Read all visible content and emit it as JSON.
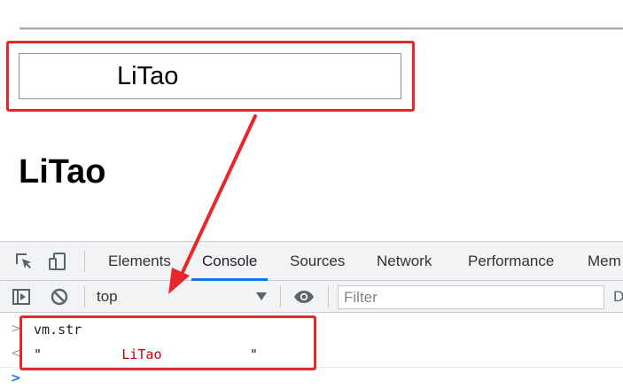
{
  "page": {
    "input_value": "LiTao",
    "heading": "LiTao"
  },
  "devtools": {
    "tabs": [
      {
        "label": "Elements",
        "active": false
      },
      {
        "label": "Console",
        "active": true
      },
      {
        "label": "Sources",
        "active": false
      },
      {
        "label": "Network",
        "active": false
      },
      {
        "label": "Performance",
        "active": false
      },
      {
        "label": "Mem",
        "active": false
      }
    ],
    "toolbar_icons": [
      "inspect-element-icon",
      "device-toggle-icon"
    ],
    "console_toolbar": {
      "context": "top",
      "filter_placeholder": "Filter",
      "truncated_label": "D"
    },
    "console": {
      "command_gutter": ">",
      "command": "vm.str",
      "result_gutter": "<",
      "result_quote_open": "\"",
      "result_value": "          LiTao           ",
      "result_quote_close": "\"",
      "prompt_gutter": ">"
    }
  },
  "colors": {
    "highlight": "#e8262b",
    "active_tab_underline": "#1a73e8",
    "string_value": "#c80000"
  }
}
